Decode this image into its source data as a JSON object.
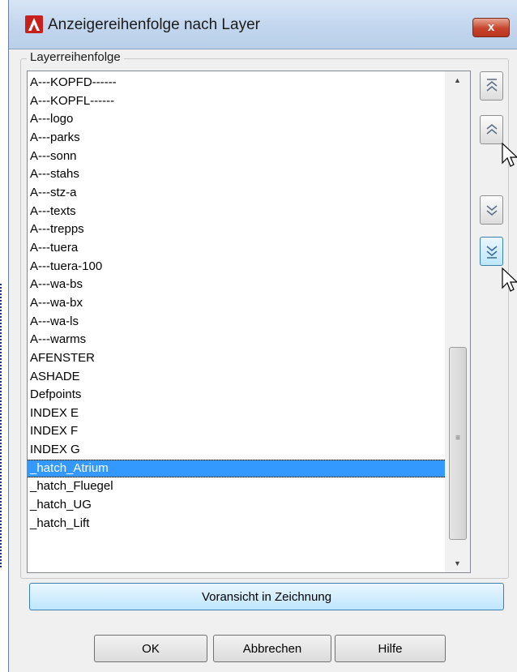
{
  "window": {
    "title": "Anzeigereihenfolge nach Layer",
    "close_label": "x"
  },
  "group": {
    "label": "Layerreihenfolge"
  },
  "layers": [
    "A---KOPFD------",
    "A---KOPFL------",
    "A---logo",
    "A---parks",
    "A---sonn",
    "A---stahs",
    "A---stz-a",
    "A---texts",
    "A---trepps",
    "A---tuera",
    "A---tuera-100",
    "A---wa-bs",
    "A---wa-bx",
    "A---wa-ls",
    "A---warms",
    "AFENSTER",
    "ASHADE",
    "Defpoints",
    "INDEX E",
    "INDEX F",
    "INDEX G",
    "_hatch_Atrium",
    "_hatch_Fluegel",
    "_hatch_UG",
    "_hatch_Lift"
  ],
  "selected_layer": "_hatch_Atrium",
  "buttons": {
    "preview": "Voransicht in Zeichnung",
    "ok": "OK",
    "cancel": "Abbrechen",
    "help": "Hilfe"
  },
  "icons": {
    "app": "autocad-logo-icon",
    "top": "move-to-top-icon",
    "up": "move-up-icon",
    "down": "move-down-icon",
    "bottom": "move-to-bottom-icon"
  },
  "colors": {
    "selection": "#3399ff",
    "accent_button": "#bee6fd",
    "close": "#c7442b"
  }
}
